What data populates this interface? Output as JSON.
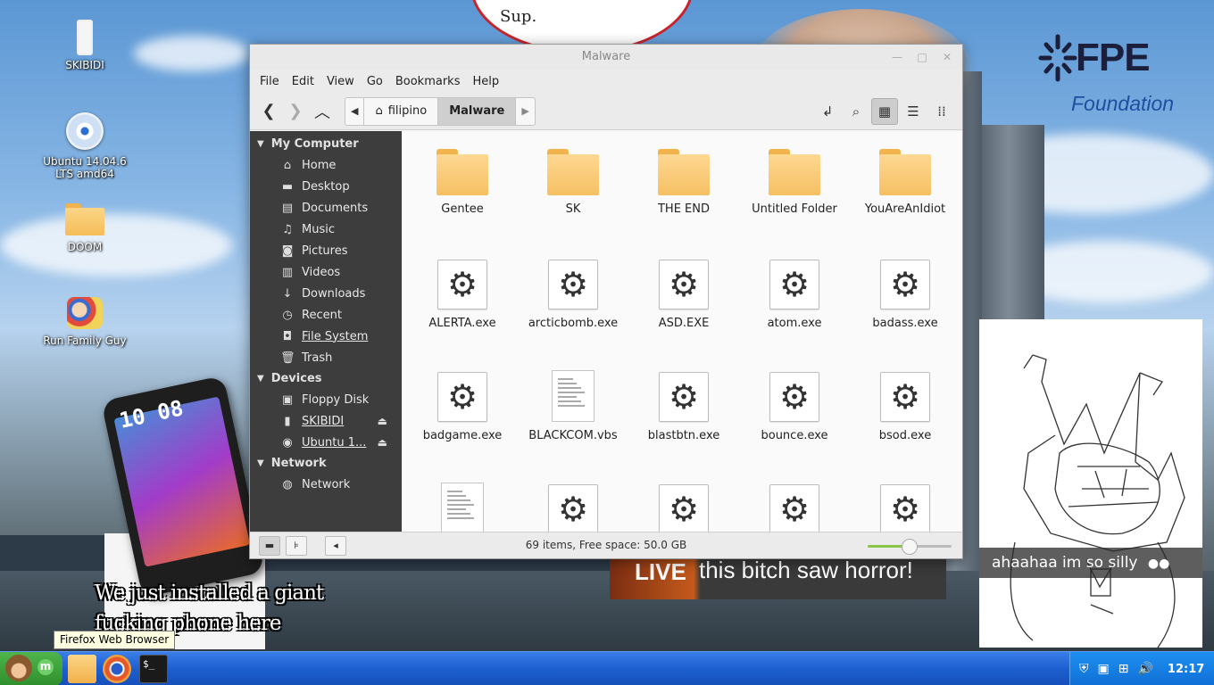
{
  "desktop": {
    "icons": [
      {
        "label": "SKIBIDI"
      },
      {
        "label": "Ubuntu 14.04.6 LTS amd64"
      },
      {
        "label": "DOOM"
      },
      {
        "label": "Run Family Guy"
      }
    ],
    "overlays": {
      "phone_clock": "10 08",
      "phone_caption_line1": "We just installed a giant",
      "phone_caption_line2": "fucking phone here",
      "live_label": "LIVE",
      "live_text": "this bitch saw horror!",
      "sketch_caption": "ahaahaa im so silly",
      "circle_text": "Sup.",
      "logo_big": "FPE",
      "logo_small": "Foundation"
    }
  },
  "window": {
    "title": "Malware",
    "menu": [
      "File",
      "Edit",
      "View",
      "Go",
      "Bookmarks",
      "Help"
    ],
    "breadcrumbs": [
      "filipino",
      "Malware"
    ],
    "sidebar": {
      "sections": [
        {
          "title": "My Computer",
          "items": [
            {
              "label": "Home",
              "icon": "home-icon"
            },
            {
              "label": "Desktop",
              "icon": "desktop-icon"
            },
            {
              "label": "Documents",
              "icon": "documents-icon"
            },
            {
              "label": "Music",
              "icon": "music-icon"
            },
            {
              "label": "Pictures",
              "icon": "pictures-icon"
            },
            {
              "label": "Videos",
              "icon": "videos-icon"
            },
            {
              "label": "Downloads",
              "icon": "downloads-icon"
            },
            {
              "label": "Recent",
              "icon": "recent-icon"
            },
            {
              "label": "File System",
              "icon": "filesystem-icon"
            },
            {
              "label": "Trash",
              "icon": "trash-icon"
            }
          ]
        },
        {
          "title": "Devices",
          "items": [
            {
              "label": "Floppy Disk",
              "icon": "floppy-icon"
            },
            {
              "label": "SKIBIDI",
              "icon": "usb-icon"
            },
            {
              "label": "Ubuntu 1...",
              "icon": "disc-icon"
            }
          ]
        },
        {
          "title": "Network",
          "items": [
            {
              "label": "Network",
              "icon": "network-icon"
            }
          ]
        }
      ]
    },
    "files": [
      {
        "name": "Gentee",
        "type": "folder"
      },
      {
        "name": "SK",
        "type": "folder"
      },
      {
        "name": "THE END",
        "type": "folder"
      },
      {
        "name": "Untitled Folder",
        "type": "folder"
      },
      {
        "name": "YouAreAnIdiot",
        "type": "folder"
      },
      {
        "name": "ALERTA.exe",
        "type": "exe"
      },
      {
        "name": "arcticbomb.exe",
        "type": "exe"
      },
      {
        "name": "ASD.EXE",
        "type": "exe"
      },
      {
        "name": "atom.exe",
        "type": "exe"
      },
      {
        "name": "badass.exe",
        "type": "exe"
      },
      {
        "name": "badgame.exe",
        "type": "exe"
      },
      {
        "name": "BLACKCOM.vbs",
        "type": "doc"
      },
      {
        "name": "blastbtn.exe",
        "type": "exe"
      },
      {
        "name": "bounce.exe",
        "type": "exe"
      },
      {
        "name": "bsod.exe",
        "type": "exe"
      },
      {
        "name": "",
        "type": "doc"
      },
      {
        "name": "",
        "type": "exe"
      },
      {
        "name": "",
        "type": "exe"
      },
      {
        "name": "",
        "type": "exe"
      },
      {
        "name": "",
        "type": "exe"
      }
    ],
    "status": "69 items, Free space: 50.0 GB",
    "zoom_level": 0.5
  },
  "taskbar": {
    "tooltip": "Firefox Web Browser",
    "start_label": "m",
    "clock": "12:17"
  },
  "colors": {
    "sidebar_bg": "#3d3d3d",
    "folder": "#f6c063",
    "taskbar": "#1d5fd0",
    "start": "#2f8f2c",
    "zoom_fill": "#8cc44a"
  }
}
